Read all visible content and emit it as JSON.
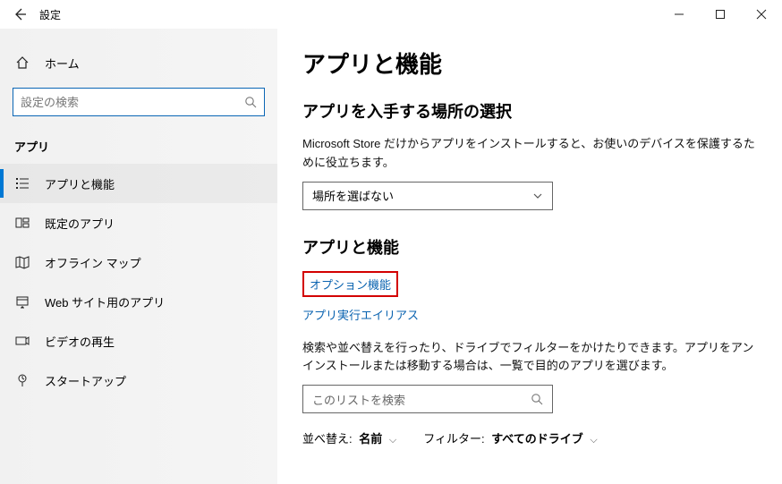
{
  "titlebar": {
    "back_aria": "戻る",
    "title": "設定"
  },
  "sidebar": {
    "home": "ホーム",
    "search_placeholder": "設定の検索",
    "section": "アプリ",
    "items": [
      {
        "label": "アプリと機能",
        "icon": "apps-list-icon",
        "active": true
      },
      {
        "label": "既定のアプリ",
        "icon": "default-apps-icon",
        "active": false
      },
      {
        "label": "オフライン マップ",
        "icon": "offline-map-icon",
        "active": false
      },
      {
        "label": "Web サイト用のアプリ",
        "icon": "web-apps-icon",
        "active": false
      },
      {
        "label": "ビデオの再生",
        "icon": "video-playback-icon",
        "active": false
      },
      {
        "label": "スタートアップ",
        "icon": "startup-icon",
        "active": false
      }
    ]
  },
  "main": {
    "heading": "アプリと機能",
    "sec1": {
      "title": "アプリを入手する場所の選択",
      "desc": "Microsoft Store だけからアプリをインストールすると、お使いのデバイスを保護するために役立ちます。",
      "combo_value": "場所を選ばない"
    },
    "sec2": {
      "title": "アプリと機能",
      "link_optional": "オプション機能",
      "link_alias": "アプリ実行エイリアス",
      "desc": "検索や並べ替えを行ったり、ドライブでフィルターをかけたりできます。アプリをアンインストールまたは移動する場合は、一覧で目的のアプリを選びます。",
      "list_search_placeholder": "このリストを検索",
      "sort_label": "並べ替え:",
      "sort_value": "名前",
      "filter_label": "フィルター:",
      "filter_value": "すべてのドライブ"
    }
  }
}
